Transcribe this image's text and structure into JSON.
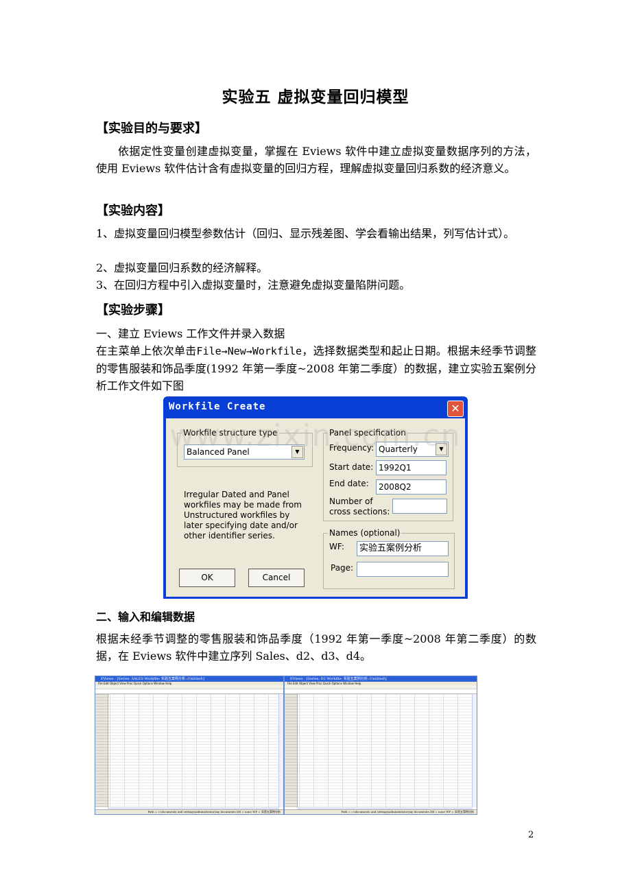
{
  "document": {
    "title": "实验五  虚拟变量回归模型",
    "sections": {
      "objective": {
        "heading": "【实验目的与要求】",
        "body": "依据定性变量创建虚拟变量，掌握在 Eviews 软件中建立虚拟变量数据序列的方法，使用 Eviews 软件估计含有虚拟变量的回归方程，理解虚拟变量回归系数的经济意义。"
      },
      "content": {
        "heading": "【实验内容】",
        "items": [
          "1、虚拟变量回归模型参数估计（回归、显示残差图、学会看输出结果，列写估计式）。",
          "2、虚拟变量回归系数的经济解释。",
          "3、在回归方程中引入虚拟变量时，注意避免虚拟变量陷阱问题。"
        ]
      },
      "steps": {
        "heading": "【实验步骤】",
        "step1_title": "一、建立 Eviews 工作文件并录入数据",
        "step1_prefix": "在主菜单上依次单击",
        "step1_menu": "File→New→Workfile",
        "step1_suffix": "，选择数据类型和起止日期。根据未经季节调整的零售服装和饰品季度(1992 年第一季度~2008 年第二季度）的数据，建立实验五案例分析工作文件如下图",
        "step2_title": "二、输入和编辑数据",
        "step2_body": "根据未经季节调整的零售服装和饰品季度（1992 年第一季度~2008 年第二季度）的数据，在 Eviews 软件中建立序列 Sales、d2、d3、d4。"
      }
    },
    "page_number": "2",
    "watermark": "www.zixin.com.cn"
  },
  "dialog": {
    "title": "Workfile Create",
    "close_icon": "close-icon",
    "structure_group_label": "Workfile structure type",
    "structure_type_value": "Balanced Panel",
    "info_text": "Irregular Dated and Panel workfiles may be made from Unstructured workfiles by later specifying date and/or other identifier series.",
    "panel_group_label": "Panel specification",
    "frequency_label": "Frequency:",
    "frequency_value": "Quarterly",
    "start_label": "Start date:",
    "start_value": "1992Q1",
    "end_label": "End date:",
    "end_value": "2008Q2",
    "cross_label_1": "Number of",
    "cross_label_2": "cross sections:",
    "cross_value": "",
    "names_group_label": "Names (optional)",
    "wf_label": "WF:",
    "wf_value": "实验五案例分析",
    "page_label": "Page:",
    "page_value": "",
    "ok_label": "OK",
    "cancel_label": "Cancel"
  },
  "screenshots": [
    {
      "title": "EViews - [Series: SALES  Workfile: 实验五案例分析::Untitled\\]",
      "menu": "File Edit Object View Proc Quick Options Window Help",
      "status": "Path = c:\\documents and settings\\administrator\\my documents   DB = none   WF = 实验五案例分析"
    },
    {
      "title": "EViews - [Series: D2  Workfile: 实验五案例分析::Untitled\\]",
      "menu": "File Edit Object View Proc Quick Options Window Help",
      "status": "Path = c:\\documents and settings\\administrator\\my documents   DB = none   WF = 实验五案例分析"
    }
  ]
}
